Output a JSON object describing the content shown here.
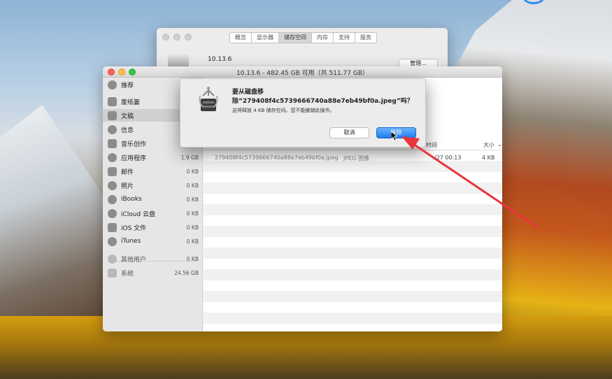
{
  "about_window": {
    "tabs": [
      "概览",
      "显示器",
      "储存空间",
      "内存",
      "支持",
      "服务"
    ],
    "selected_tab": 2,
    "version": "10.13.6",
    "manage_button": "管理..."
  },
  "storage_window": {
    "title": "10.13.6 - 482.45 GB 可用（共 511.77 GB）",
    "sidebar": [
      {
        "label": "推荐",
        "size": "",
        "icon": "lightbulb-icon"
      },
      {
        "label": "废纸篓",
        "size": "",
        "icon": "trash-icon"
      },
      {
        "label": "文稿",
        "size": "",
        "icon": "document-icon",
        "selected": true
      },
      {
        "label": "信息",
        "size": "",
        "icon": "message-icon"
      },
      {
        "label": "音乐创作",
        "size": "",
        "icon": "music-icon"
      },
      {
        "label": "应用程序",
        "size": "1.9 GB",
        "icon": "app-icon"
      },
      {
        "label": "邮件",
        "size": "0 KB",
        "icon": "mail-icon"
      },
      {
        "label": "照片",
        "size": "0 KB",
        "icon": "photos-icon"
      },
      {
        "label": "iBooks",
        "size": "0 KB",
        "icon": "book-icon"
      },
      {
        "label": "iCloud 云盘",
        "size": "0 KB",
        "icon": "cloud-icon"
      },
      {
        "label": "iOS 文件",
        "size": "0 KB",
        "icon": "phone-icon"
      },
      {
        "label": "iTunes",
        "size": "0 KB",
        "icon": "itunes-icon"
      },
      {
        "label": "其他用户",
        "size": "0 KB",
        "icon": "user-icon",
        "dim": true
      },
      {
        "label": "系统",
        "size": "24.56 GB",
        "icon": "gear-icon",
        "dim": true
      }
    ],
    "table": {
      "col_time": "时间",
      "col_size": "大小",
      "row": {
        "name": "279408f4c5739666740a88e7eb49bf0a.jpeg",
        "kind": "JPEG 图像",
        "time": "/27 00:13",
        "size": "4 KB"
      }
    }
  },
  "dialog": {
    "title_line1": "要从磁盘移",
    "title_line2": "除“279408f4c5739666740a88e7eb49bf0a.jpeg”吗？",
    "message": "这将释放 4 KB 储存空间。您不能撤销此操作。",
    "cancel_label": "取消",
    "remove_label": "移除"
  },
  "colors": {
    "accent": "#1f7cf1",
    "annotation_arrow": "#e8353a"
  }
}
